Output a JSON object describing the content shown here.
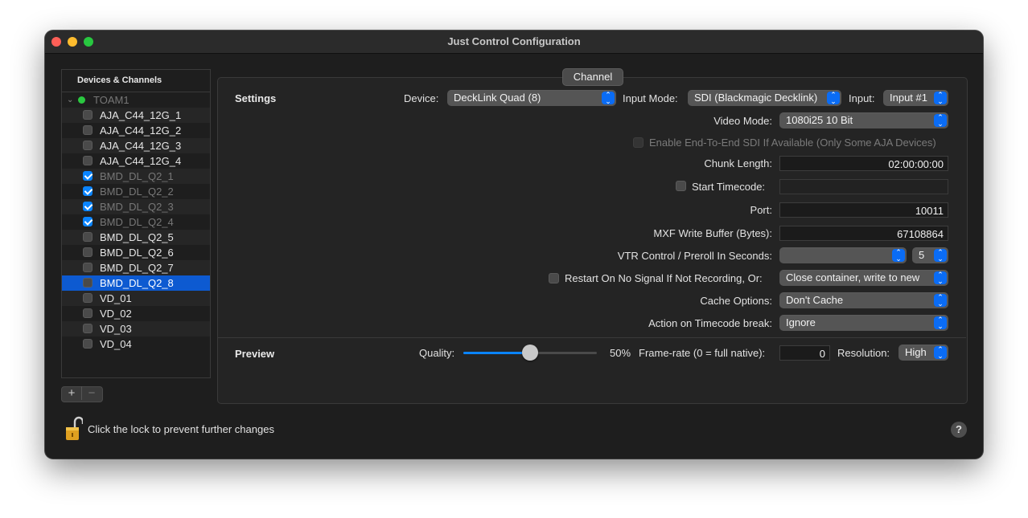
{
  "window": {
    "title": "Just Control Configuration"
  },
  "sidebar": {
    "header": "Devices & Channels",
    "group": {
      "label": "TOAM1",
      "status_color": "#2ac840"
    },
    "items": [
      {
        "label": "AJA_C44_12G_1",
        "checked": false,
        "dim": false,
        "selected": false
      },
      {
        "label": "AJA_C44_12G_2",
        "checked": false,
        "dim": false,
        "selected": false
      },
      {
        "label": "AJA_C44_12G_3",
        "checked": false,
        "dim": false,
        "selected": false
      },
      {
        "label": "AJA_C44_12G_4",
        "checked": false,
        "dim": false,
        "selected": false
      },
      {
        "label": "BMD_DL_Q2_1",
        "checked": true,
        "dim": true,
        "selected": false
      },
      {
        "label": "BMD_DL_Q2_2",
        "checked": true,
        "dim": true,
        "selected": false
      },
      {
        "label": "BMD_DL_Q2_3",
        "checked": true,
        "dim": true,
        "selected": false
      },
      {
        "label": "BMD_DL_Q2_4",
        "checked": true,
        "dim": true,
        "selected": false
      },
      {
        "label": "BMD_DL_Q2_5",
        "checked": false,
        "dim": false,
        "selected": false
      },
      {
        "label": "BMD_DL_Q2_6",
        "checked": false,
        "dim": false,
        "selected": false
      },
      {
        "label": "BMD_DL_Q2_7",
        "checked": false,
        "dim": false,
        "selected": false
      },
      {
        "label": "BMD_DL_Q2_8",
        "checked": false,
        "dim": false,
        "selected": true
      },
      {
        "label": "VD_01",
        "checked": false,
        "dim": false,
        "selected": false
      },
      {
        "label": "VD_02",
        "checked": false,
        "dim": false,
        "selected": false
      },
      {
        "label": "VD_03",
        "checked": false,
        "dim": false,
        "selected": false
      },
      {
        "label": "VD_04",
        "checked": false,
        "dim": false,
        "selected": false
      }
    ],
    "add_label": "+",
    "remove_label": "−"
  },
  "tab": {
    "label": "Channel"
  },
  "settings": {
    "section": "Settings",
    "device_label": "Device:",
    "device_value": "DeckLink Quad (8)",
    "input_mode_label": "Input Mode:",
    "input_mode_value": "SDI (Blackmagic Decklink)",
    "input_label": "Input:",
    "input_value": "Input #1",
    "video_mode_label": "Video Mode:",
    "video_mode_value": "1080i25 10 Bit",
    "e2e_label": "Enable End-To-End SDI If Available (Only Some AJA Devices)",
    "chunk_label": "Chunk Length:",
    "chunk_value": "02:00:00:00",
    "start_tc_label": "Start Timecode:",
    "start_tc_value": "",
    "port_label": "Port:",
    "port_value": "10011",
    "mxf_label": "MXF Write Buffer (Bytes):",
    "mxf_value": "67108864",
    "vtr_label": "VTR Control / Preroll In Seconds:",
    "vtr_value": "",
    "preroll_value": "5",
    "restart_label": "Restart On No Signal If Not Recording, Or:",
    "restart_value": "Close container, write to new",
    "cache_label": "Cache Options:",
    "cache_value": "Don't Cache",
    "tc_break_label": "Action on Timecode break:",
    "tc_break_value": "Ignore"
  },
  "preview": {
    "section": "Preview",
    "quality_label": "Quality:",
    "quality_value": 50,
    "quality_text": "50%",
    "framerate_label": "Frame-rate (0 = full native):",
    "framerate_value": "0",
    "resolution_label": "Resolution:",
    "resolution_value": "High"
  },
  "footer": {
    "lock_text": "Click the lock to prevent further changes",
    "help_label": "?"
  },
  "colors": {
    "accent": "#0a84ff",
    "selection": "#0d5ad1"
  }
}
